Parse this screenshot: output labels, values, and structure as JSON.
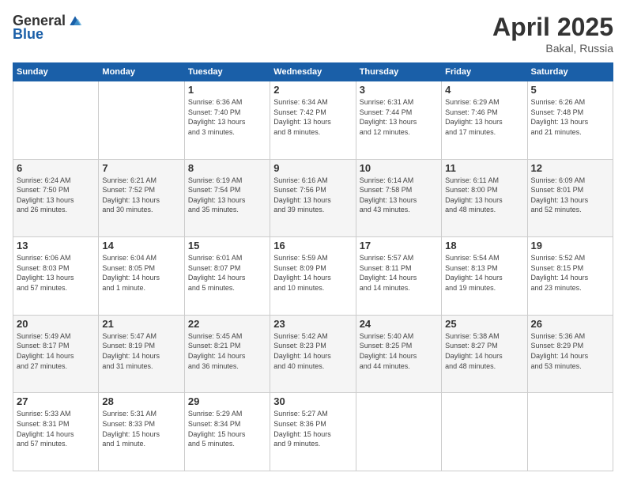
{
  "header": {
    "logo": {
      "general": "General",
      "blue": "Blue"
    },
    "title": "April 2025",
    "subtitle": "Bakal, Russia"
  },
  "calendar": {
    "weekdays": [
      "Sunday",
      "Monday",
      "Tuesday",
      "Wednesday",
      "Thursday",
      "Friday",
      "Saturday"
    ],
    "weeks": [
      [
        {
          "day": "",
          "info": ""
        },
        {
          "day": "",
          "info": ""
        },
        {
          "day": "1",
          "info": "Sunrise: 6:36 AM\nSunset: 7:40 PM\nDaylight: 13 hours\nand 3 minutes."
        },
        {
          "day": "2",
          "info": "Sunrise: 6:34 AM\nSunset: 7:42 PM\nDaylight: 13 hours\nand 8 minutes."
        },
        {
          "day": "3",
          "info": "Sunrise: 6:31 AM\nSunset: 7:44 PM\nDaylight: 13 hours\nand 12 minutes."
        },
        {
          "day": "4",
          "info": "Sunrise: 6:29 AM\nSunset: 7:46 PM\nDaylight: 13 hours\nand 17 minutes."
        },
        {
          "day": "5",
          "info": "Sunrise: 6:26 AM\nSunset: 7:48 PM\nDaylight: 13 hours\nand 21 minutes."
        }
      ],
      [
        {
          "day": "6",
          "info": "Sunrise: 6:24 AM\nSunset: 7:50 PM\nDaylight: 13 hours\nand 26 minutes."
        },
        {
          "day": "7",
          "info": "Sunrise: 6:21 AM\nSunset: 7:52 PM\nDaylight: 13 hours\nand 30 minutes."
        },
        {
          "day": "8",
          "info": "Sunrise: 6:19 AM\nSunset: 7:54 PM\nDaylight: 13 hours\nand 35 minutes."
        },
        {
          "day": "9",
          "info": "Sunrise: 6:16 AM\nSunset: 7:56 PM\nDaylight: 13 hours\nand 39 minutes."
        },
        {
          "day": "10",
          "info": "Sunrise: 6:14 AM\nSunset: 7:58 PM\nDaylight: 13 hours\nand 43 minutes."
        },
        {
          "day": "11",
          "info": "Sunrise: 6:11 AM\nSunset: 8:00 PM\nDaylight: 13 hours\nand 48 minutes."
        },
        {
          "day": "12",
          "info": "Sunrise: 6:09 AM\nSunset: 8:01 PM\nDaylight: 13 hours\nand 52 minutes."
        }
      ],
      [
        {
          "day": "13",
          "info": "Sunrise: 6:06 AM\nSunset: 8:03 PM\nDaylight: 13 hours\nand 57 minutes."
        },
        {
          "day": "14",
          "info": "Sunrise: 6:04 AM\nSunset: 8:05 PM\nDaylight: 14 hours\nand 1 minute."
        },
        {
          "day": "15",
          "info": "Sunrise: 6:01 AM\nSunset: 8:07 PM\nDaylight: 14 hours\nand 5 minutes."
        },
        {
          "day": "16",
          "info": "Sunrise: 5:59 AM\nSunset: 8:09 PM\nDaylight: 14 hours\nand 10 minutes."
        },
        {
          "day": "17",
          "info": "Sunrise: 5:57 AM\nSunset: 8:11 PM\nDaylight: 14 hours\nand 14 minutes."
        },
        {
          "day": "18",
          "info": "Sunrise: 5:54 AM\nSunset: 8:13 PM\nDaylight: 14 hours\nand 19 minutes."
        },
        {
          "day": "19",
          "info": "Sunrise: 5:52 AM\nSunset: 8:15 PM\nDaylight: 14 hours\nand 23 minutes."
        }
      ],
      [
        {
          "day": "20",
          "info": "Sunrise: 5:49 AM\nSunset: 8:17 PM\nDaylight: 14 hours\nand 27 minutes."
        },
        {
          "day": "21",
          "info": "Sunrise: 5:47 AM\nSunset: 8:19 PM\nDaylight: 14 hours\nand 31 minutes."
        },
        {
          "day": "22",
          "info": "Sunrise: 5:45 AM\nSunset: 8:21 PM\nDaylight: 14 hours\nand 36 minutes."
        },
        {
          "day": "23",
          "info": "Sunrise: 5:42 AM\nSunset: 8:23 PM\nDaylight: 14 hours\nand 40 minutes."
        },
        {
          "day": "24",
          "info": "Sunrise: 5:40 AM\nSunset: 8:25 PM\nDaylight: 14 hours\nand 44 minutes."
        },
        {
          "day": "25",
          "info": "Sunrise: 5:38 AM\nSunset: 8:27 PM\nDaylight: 14 hours\nand 48 minutes."
        },
        {
          "day": "26",
          "info": "Sunrise: 5:36 AM\nSunset: 8:29 PM\nDaylight: 14 hours\nand 53 minutes."
        }
      ],
      [
        {
          "day": "27",
          "info": "Sunrise: 5:33 AM\nSunset: 8:31 PM\nDaylight: 14 hours\nand 57 minutes."
        },
        {
          "day": "28",
          "info": "Sunrise: 5:31 AM\nSunset: 8:33 PM\nDaylight: 15 hours\nand 1 minute."
        },
        {
          "day": "29",
          "info": "Sunrise: 5:29 AM\nSunset: 8:34 PM\nDaylight: 15 hours\nand 5 minutes."
        },
        {
          "day": "30",
          "info": "Sunrise: 5:27 AM\nSunset: 8:36 PM\nDaylight: 15 hours\nand 9 minutes."
        },
        {
          "day": "",
          "info": ""
        },
        {
          "day": "",
          "info": ""
        },
        {
          "day": "",
          "info": ""
        }
      ]
    ]
  }
}
